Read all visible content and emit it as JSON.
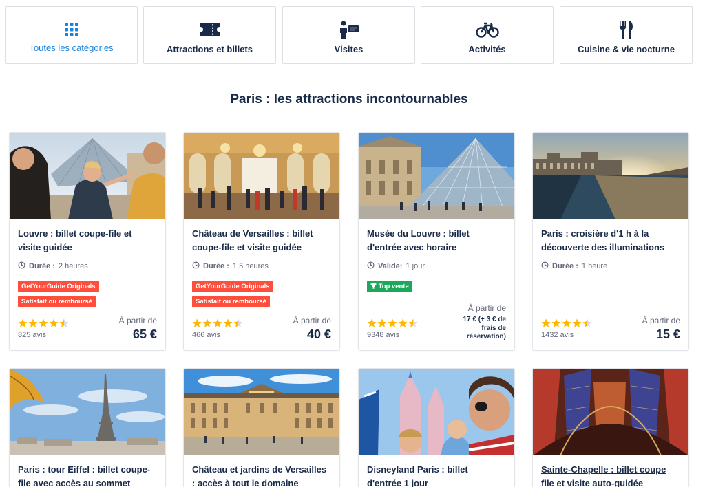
{
  "categories": [
    {
      "label": "Toutes les catégories",
      "icon": "grid-icon",
      "active": true
    },
    {
      "label": "Attractions et billets",
      "icon": "ticket-icon",
      "active": false
    },
    {
      "label": "Visites",
      "icon": "guide-icon",
      "active": false
    },
    {
      "label": "Activités",
      "icon": "bicycle-icon",
      "active": false
    },
    {
      "label": "Cuisine & vie nocturne",
      "icon": "fork-knife-icon",
      "active": false
    }
  ],
  "section_title": "Paris : les attractions incontournables",
  "cards": [
    {
      "title": "Louvre : billet coupe-file et visite guidée",
      "meta_label": "Durée :",
      "meta_value": "2 heures",
      "badges": [
        "GetYourGuide Originals",
        "Satisfait ou remboursé"
      ],
      "rating": 4.5,
      "reviews": "825 avis",
      "price_label": "À partir de",
      "price": "65 €"
    },
    {
      "title": "Château de Versailles : billet coupe-file et visite guidée",
      "meta_label": "Durée :",
      "meta_value": "1,5 heures",
      "badges": [
        "GetYourGuide Originals",
        "Satisfait ou remboursé"
      ],
      "rating": 4.5,
      "reviews": "466 avis",
      "price_label": "À partir de",
      "price": "40 €"
    },
    {
      "title": "Musée du Louvre : billet d'entrée avec horaire",
      "meta_label": "Valide:",
      "meta_value": "1 jour",
      "badges": [
        "Top vente"
      ],
      "rating": 4.5,
      "reviews": "9348 avis",
      "price_label": "À partir de",
      "price": "17 € (+ 3 € de frais de réservation)"
    },
    {
      "title": "Paris : croisière d'1 h à la découverte des illuminations",
      "meta_label": "Durée :",
      "meta_value": "1 heure",
      "badges": [],
      "rating": 4.5,
      "reviews": "1432 avis",
      "price_label": "À partir de",
      "price": "15 €"
    },
    {
      "title": "Paris : tour Eiffel : billet coupe-file avec accès au sommet"
    },
    {
      "title": "Château et jardins de Versailles : accès à tout le domaine"
    },
    {
      "title": "Disneyland Paris : billet d'entrée 1 jour"
    },
    {
      "title": "Sainte-Chapelle : billet coupe file et visite auto-guidée"
    }
  ],
  "colors": {
    "accent": "#1583e0",
    "text": "#1a2b49",
    "badge_red": "#ff4f3c",
    "badge_green": "#1aa85b",
    "star": "#ffb800"
  }
}
